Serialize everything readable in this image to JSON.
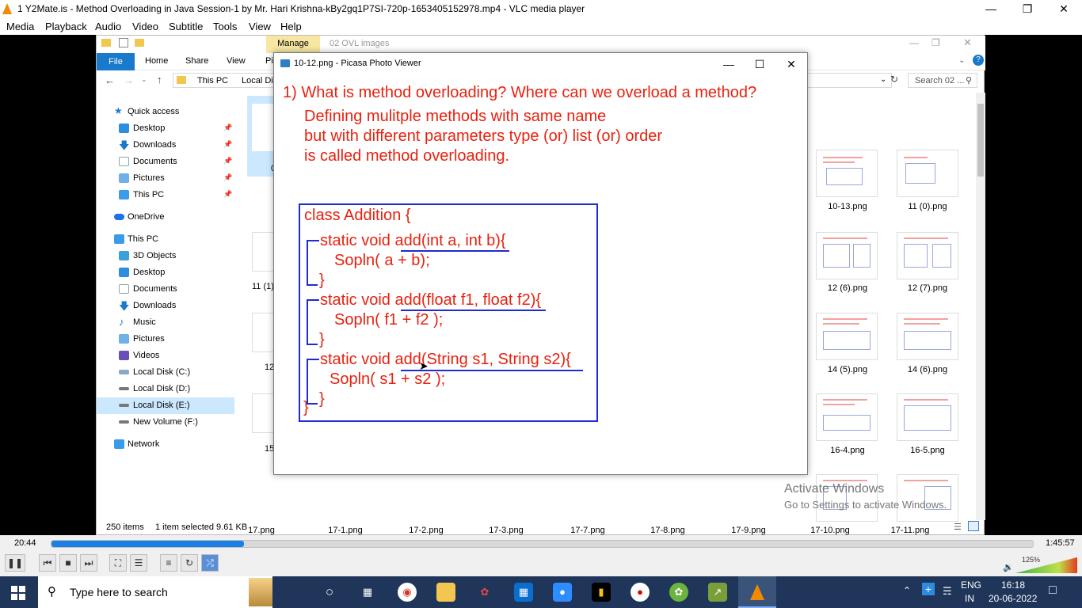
{
  "vlc": {
    "title": "1 Y2Mate.is - Method Overloading in Java  Session-1  by Mr. Hari Krishna-kBy2gq1P7SI-720p-1653405152978.mp4 - VLC media player",
    "menu": [
      "Media",
      "Playback",
      "Audio",
      "Video",
      "Subtitle",
      "Tools",
      "View",
      "Help"
    ],
    "time_elapsed": "20:44",
    "time_total": "1:45:57",
    "progress": 0.196,
    "volume": "125%"
  },
  "explorer": {
    "ribbon_tabs": [
      "File",
      "Home",
      "Share",
      "View",
      "Pic"
    ],
    "manage_tab": "Manage",
    "folder_title": "02 OVL images",
    "breadcrumb": [
      "This PC",
      "Local Dis"
    ],
    "search_placeholder": "Search 02 ...",
    "nav": {
      "quick_access": "Quick access",
      "qa_items": [
        "Desktop",
        "Downloads",
        "Documents",
        "Pictures",
        "This PC"
      ],
      "onedrive": "OneDrive",
      "this_pc": "This PC",
      "pc_items": [
        "3D Objects",
        "Desktop",
        "Documents",
        "Downloads",
        "Music",
        "Pictures",
        "Videos",
        "Local Disk (C:)",
        "Local Disk (D:)",
        "Local Disk (E:)",
        "New Volume (F:)"
      ],
      "network": "Network"
    },
    "files_right": [
      [
        "10-13.png",
        "11 (0).png"
      ],
      [
        "12 (6).png",
        "12 (7).png"
      ],
      [
        "14 (5).png",
        "14 (6).png"
      ],
      [
        "16-4.png",
        "16-5.png"
      ]
    ],
    "files_left_partial": [
      "0",
      "11 (1)",
      "12",
      "15"
    ],
    "bottom_row": [
      "17.png",
      "17-1.png",
      "17-2.png",
      "17-3.png",
      "17-7.png",
      "17-8.png",
      "17-9.png",
      "17-10.png",
      "17-11.png"
    ],
    "status_items": "250 items",
    "status_selected": "1 item selected  9.61 KB"
  },
  "picasa": {
    "title": "10-12.png - Picasa Photo Viewer",
    "question": "1) What is method overloading? Where can we overload a method?",
    "def_lines": [
      "Defining mulitple methods with same name",
      "but with different parameters type (or) list (or) order",
      "is called method overloading."
    ],
    "code": {
      "class_line": "class Addition {",
      "m1_sig": "static void add(int a, int b){",
      "m1_body": "Sopln( a + b);",
      "m1_close": "}",
      "m2_sig": "static void add(float f1, float f2){",
      "m2_body": "Sopln( f1 + f2 );",
      "m2_close": "}",
      "m3_sig": "static void add(String s1, String s2){",
      "m3_body": "Sopln( s1 + s2 );",
      "m3_close": "}",
      "class_close": "}"
    }
  },
  "watermark": {
    "line1": "Activate Windows",
    "line2": "Go to Settings to activate Windows."
  },
  "taskbar": {
    "search_placeholder": "Type here to search",
    "lang": "ENG",
    "region": "IN",
    "time": "16:18",
    "date": "20-06-2022"
  }
}
